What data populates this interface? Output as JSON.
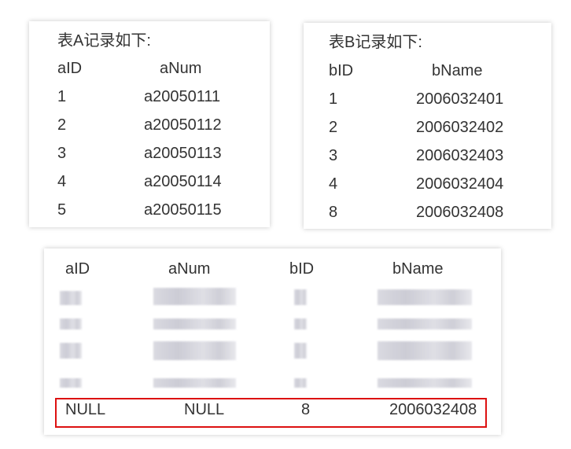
{
  "table_a": {
    "title": "表A记录如下:",
    "headers": [
      "aID",
      "aNum"
    ],
    "rows": [
      [
        "1",
        "a20050111"
      ],
      [
        "2",
        "a20050112"
      ],
      [
        "3",
        "a20050113"
      ],
      [
        "4",
        "a20050114"
      ],
      [
        "5",
        "a20050115"
      ]
    ]
  },
  "table_b": {
    "title": "表B记录如下:",
    "headers": [
      "bID",
      "bName"
    ],
    "rows": [
      [
        "1",
        "2006032401"
      ],
      [
        "2",
        "2006032402"
      ],
      [
        "3",
        "2006032403"
      ],
      [
        "4",
        "2006032404"
      ],
      [
        "8",
        "2006032408"
      ]
    ]
  },
  "result": {
    "headers": [
      "aID",
      "aNum",
      "bID",
      "bName"
    ],
    "highlight_row": [
      "NULL",
      "NULL",
      "8",
      "2006032408"
    ],
    "highlight_color": "#dd1111"
  }
}
